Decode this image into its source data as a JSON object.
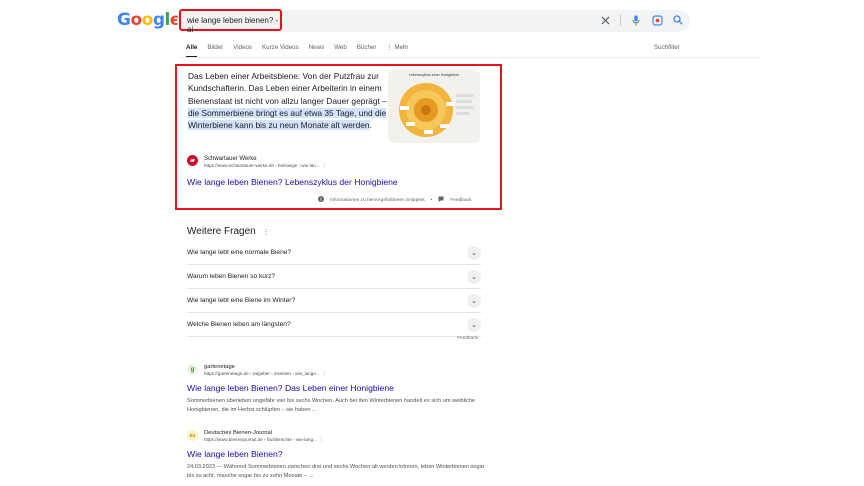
{
  "logo": {
    "letters": [
      "G",
      "o",
      "o",
      "g",
      "l",
      "e"
    ],
    "colors": [
      "#4285f4",
      "#ea4335",
      "#fbbc05",
      "#4285f4",
      "#34a853",
      "#ea4335"
    ]
  },
  "search": {
    "query": "wie lange leben bienen? -ai"
  },
  "tabs": [
    {
      "label": "Alle",
      "active": true
    },
    {
      "label": "Bilder"
    },
    {
      "label": "Videos"
    },
    {
      "label": "Kurze Videos"
    },
    {
      "label": "News"
    },
    {
      "label": "Web"
    },
    {
      "label": "Bücher"
    },
    {
      "label": "⋮ Mehr"
    }
  ],
  "tools_label": "Suchfilter",
  "snippet": {
    "text_before": "Das Leben einer Arbeitsbiene: Von der Putzfrau zur Kundschafterin. Das Leben einer Arbeiterin in einem Bienenstaat ist nicht von allzu langer Dauer geprägt – ",
    "text_highlight": "die Sommerbiene bringt es auf etwa 35 Tage, und die Winterbiene kann bis zu neun Monate alt werden",
    "text_after": ".",
    "image_title": "Lebenszyklus einer Honigbiene",
    "source_name": "Schwartauer Werke",
    "source_url": "https://www.schwartauer-werke.de › beitraege › wie-lan...",
    "source_menu": "⋮",
    "link": "Wie lange leben Bienen? Lebenszyklus der Honigbiene",
    "footer_info": "Informationen zu hervorgehobenen Snippets",
    "footer_sep": "•",
    "footer_feedback": "Feedback"
  },
  "paa": {
    "title": "Weitere Fragen",
    "menu": "⋮",
    "questions": [
      "Wie lange lebt eine normale Biene?",
      "Warum leben Bienen so kurz?",
      "Wie lange lebt eine Biene im Winter?",
      "Welche Bienen leben am längsten?"
    ],
    "feedback": "Feedback"
  },
  "results": [
    {
      "site": "gartenetage",
      "url": "https://gartenetage.de › ratgeber › insekten › wie_lange...",
      "menu": "⋮",
      "favicon": "g",
      "favicon_color": "#3c8d2f",
      "title": "Wie lange leben Bienen? Das Leben einer Honigbiene",
      "desc": "Sommerbienen überleben ungefähr vier bis sechs Wochen. Auch bei den Winterbienen handelt es sich um weibliche Honigbienen, die im Herbst schlüpfen – sie haben ..."
    },
    {
      "site": "Deutsches Bienen-Journal",
      "url": "https://www.bienenjournal.de › fachberichte › wie-lang...",
      "menu": "⋮",
      "favicon": "BJ",
      "favicon_color": "#e0a800",
      "title": "Wie lange leben Bienen?",
      "desc": "24.03.2023 — Während Sommerbienen zwischen drei und sechs Wochen alt werden können, leben Winterbienen sogar bis zu acht, manche sogar bis zu zehn Monate – ..."
    }
  ]
}
